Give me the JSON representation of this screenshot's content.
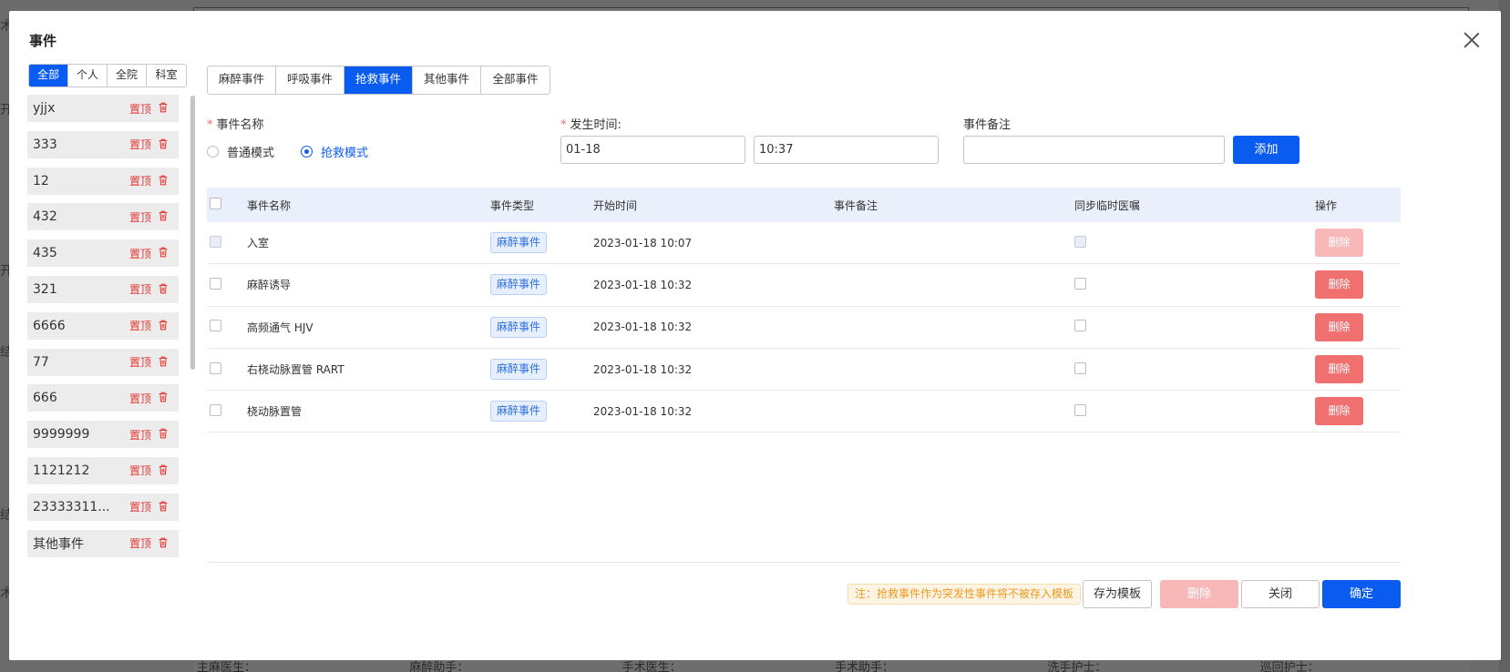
{
  "background": {
    "left_glyphs": [
      "术",
      "开",
      "开",
      "结",
      "结",
      "术"
    ],
    "bottom_labels": [
      "主麻医生：",
      "麻醉助手：",
      "手术医生：",
      "手术助手：",
      "洗手护士：",
      "巡回护士："
    ]
  },
  "dialog": {
    "title": "事件"
  },
  "scope_tabs": [
    {
      "label": "全部",
      "active": true
    },
    {
      "label": "个人",
      "active": false
    },
    {
      "label": "全院",
      "active": false
    },
    {
      "label": "科室",
      "active": false
    }
  ],
  "left_list": {
    "pin_label": "置顶",
    "items": [
      "yjjx",
      "333",
      "12",
      "432",
      "435",
      "321",
      "6666",
      "77",
      "666",
      "9999999",
      "1121212",
      "23333311...",
      "其他事件"
    ]
  },
  "type_tabs": [
    {
      "label": "麻醉事件",
      "active": false
    },
    {
      "label": "呼吸事件",
      "active": false
    },
    {
      "label": "抢救事件",
      "active": true
    },
    {
      "label": "其他事件",
      "active": false
    },
    {
      "label": "全部事件",
      "active": false
    }
  ],
  "form": {
    "event_name_label": "事件名称",
    "mode_normal": "普通模式",
    "mode_rescue": "抢救模式",
    "time_label": "发生时间:",
    "date_value": "01-18",
    "time_value": "10:37",
    "note_label": "事件备注",
    "note_value": "",
    "add_button": "添加"
  },
  "table": {
    "headers": {
      "name": "事件名称",
      "type": "事件类型",
      "start": "开始时间",
      "note": "事件备注",
      "sync": "同步临时医嘱",
      "op": "操作"
    },
    "delete_label": "删除",
    "rows": [
      {
        "name": "入室",
        "type": "麻醉事件",
        "start": "2023-01-18 10:07",
        "note": "",
        "disabled": true
      },
      {
        "name": "麻醉诱导",
        "type": "麻醉事件",
        "start": "2023-01-18 10:32",
        "note": "",
        "disabled": false
      },
      {
        "name": "高频通气 HJV",
        "type": "麻醉事件",
        "start": "2023-01-18 10:32",
        "note": "",
        "disabled": false
      },
      {
        "name": "右桡动脉置管 RART",
        "type": "麻醉事件",
        "start": "2023-01-18 10:32",
        "note": "",
        "disabled": false
      },
      {
        "name": "桡动脉置管",
        "type": "麻醉事件",
        "start": "2023-01-18 10:32",
        "note": "",
        "disabled": false
      }
    ]
  },
  "footer": {
    "note": "注：抢救事件作为突发性事件将不被存入模板",
    "save_template": "存为模板",
    "delete": "删除",
    "close": "关闭",
    "confirm": "确定"
  },
  "colors": {
    "primary": "#0a5bf0",
    "danger": "#f07070",
    "warning": "#f09a20"
  }
}
